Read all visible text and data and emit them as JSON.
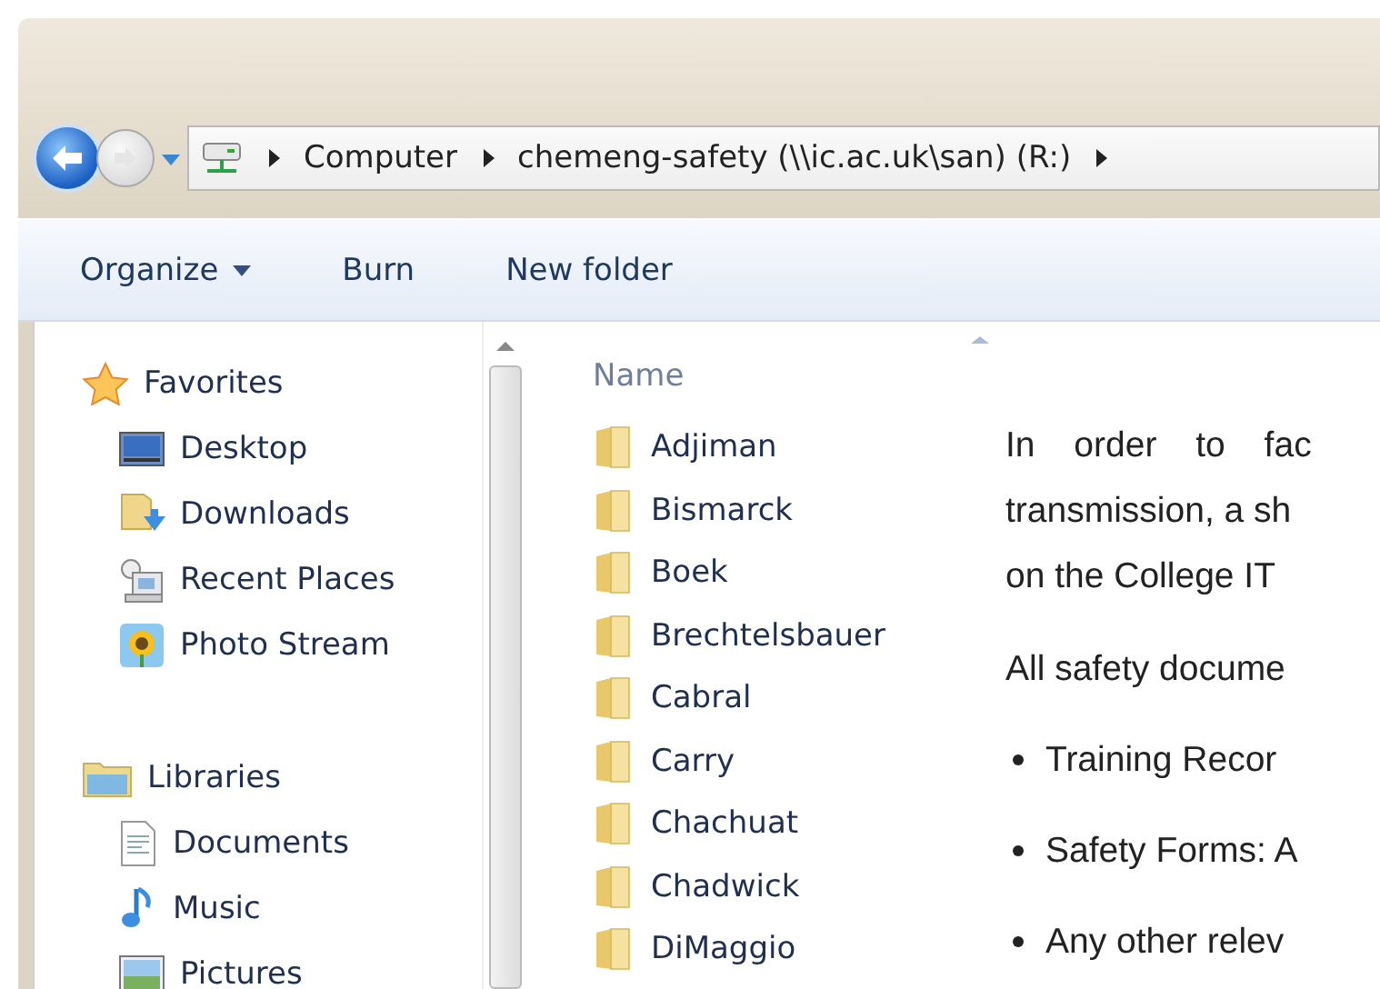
{
  "address_bar": {
    "segments": [
      "Computer",
      "chemeng-safety (\\\\ic.ac.uk\\san) (R:)"
    ]
  },
  "toolbar": {
    "buttons": [
      {
        "label": "Organize",
        "dropdown": true
      },
      {
        "label": "Burn",
        "dropdown": false
      },
      {
        "label": "New folder",
        "dropdown": false
      }
    ]
  },
  "navigation_pane": {
    "groups": [
      {
        "label": "Favorites",
        "kind": "favorites",
        "children": [
          {
            "label": "Desktop",
            "kind": "desktop"
          },
          {
            "label": "Downloads",
            "kind": "downloads"
          },
          {
            "label": "Recent Places",
            "kind": "recent"
          },
          {
            "label": "Photo Stream",
            "kind": "photos"
          }
        ]
      },
      {
        "label": "Libraries",
        "kind": "libraries",
        "children": [
          {
            "label": "Documents",
            "kind": "documents"
          },
          {
            "label": "Music",
            "kind": "music"
          },
          {
            "label": "Pictures",
            "kind": "pictures"
          }
        ]
      }
    ]
  },
  "file_list": {
    "columns": [
      "Name"
    ],
    "items": [
      "Adjiman",
      "Bismarck",
      "Boek",
      "Brechtelsbauer",
      "Cabral",
      "Carry",
      "Chachuat",
      "Chadwick",
      "DiMaggio"
    ]
  },
  "document": {
    "paragraph_lines": [
      "In order to fac",
      "transmission, a sh",
      "on the College IT"
    ],
    "intro": "All safety docume",
    "bullets": [
      "Training Recor",
      "Safety Forms: A",
      "Any other relev"
    ]
  }
}
